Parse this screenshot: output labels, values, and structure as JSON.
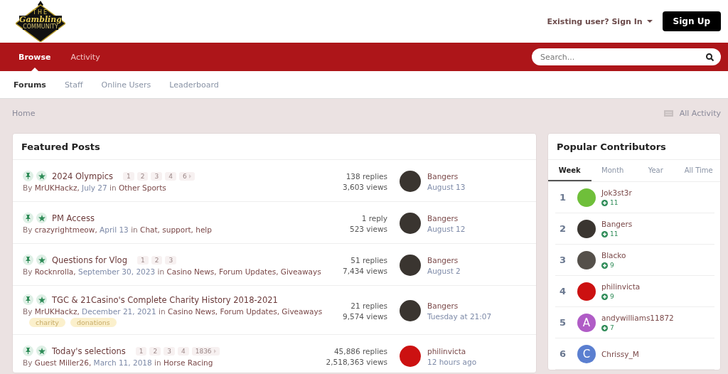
{
  "logo": {
    "top": "THE",
    "middle": "Gambling",
    "bottom": "COMMUNITY"
  },
  "user_bar": {
    "sign_in": "Existing user? Sign In",
    "sign_up": "Sign Up"
  },
  "nav_tabs": [
    {
      "label": "Browse",
      "selected": true
    },
    {
      "label": "Activity",
      "selected": false
    }
  ],
  "search": {
    "placeholder": "Search..."
  },
  "sub_tabs": [
    {
      "label": "Forums",
      "selected": true
    },
    {
      "label": "Staff",
      "selected": false
    },
    {
      "label": "Online Users",
      "selected": false
    },
    {
      "label": "Leaderboard",
      "selected": false
    }
  ],
  "breadcrumb": {
    "home": "Home",
    "all_activity": "All Activity"
  },
  "featured": {
    "title": "Featured Posts",
    "posts": [
      {
        "title": "2024 Olympics",
        "pinned": true,
        "featured": true,
        "pages": [
          {
            "label": "1",
            "kind": "page"
          },
          {
            "label": "2",
            "kind": "page"
          },
          {
            "label": "3",
            "kind": "page"
          },
          {
            "label": "4",
            "kind": "page"
          },
          {
            "label": "6",
            "kind": "last"
          }
        ],
        "meta": [
          {
            "kind": "text",
            "text": "By"
          },
          {
            "kind": "link",
            "text": "MrUKHackz,"
          },
          {
            "kind": "date",
            "text": "July 27"
          },
          {
            "kind": "text",
            "text": "in"
          },
          {
            "kind": "link",
            "text": "Other Sports"
          }
        ],
        "replies": "138 replies",
        "views": "3,603 views",
        "last_user": "Bangers",
        "last_time": "August 13",
        "color": "#3a3530"
      },
      {
        "title": "PM Access",
        "pinned": true,
        "featured": true,
        "meta": [
          {
            "kind": "text",
            "text": "By"
          },
          {
            "kind": "link",
            "text": "crazyrightmeow,"
          },
          {
            "kind": "date",
            "text": "April 13"
          },
          {
            "kind": "text",
            "text": "in"
          },
          {
            "kind": "link",
            "text": "Chat, support, help"
          }
        ],
        "replies": "1 reply",
        "views": "523 views",
        "last_user": "Bangers",
        "last_time": "August 12",
        "color": "#3a3530"
      },
      {
        "title": "Questions for Vlog",
        "pinned": true,
        "featured": true,
        "pages": [
          {
            "label": "1",
            "kind": "page"
          },
          {
            "label": "2",
            "kind": "page"
          },
          {
            "label": "3",
            "kind": "page"
          }
        ],
        "meta": [
          {
            "kind": "text",
            "text": "By"
          },
          {
            "kind": "link",
            "text": "Rocknrolla,"
          },
          {
            "kind": "date",
            "text": "September 30, 2023"
          },
          {
            "kind": "text",
            "text": "in"
          },
          {
            "kind": "link",
            "text": "Casino News, Forum Updates, Giveaways"
          }
        ],
        "replies": "51 replies",
        "views": "7,434 views",
        "last_user": "Bangers",
        "last_time": "August 2",
        "color": "#3a3530"
      },
      {
        "title": "TGC & 21Casino's Complete Charity History 2018-2021",
        "pinned": true,
        "featured": true,
        "meta": [
          {
            "kind": "text",
            "text": "By"
          },
          {
            "kind": "link",
            "text": "MrUKHackz,"
          },
          {
            "kind": "date",
            "text": "December 21, 2021"
          },
          {
            "kind": "text",
            "text": "in"
          },
          {
            "kind": "link",
            "text": "Casino News, Forum Updates, Giveaways"
          }
        ],
        "tags": [
          "charity",
          "donations"
        ],
        "replies": "21 replies",
        "views": "9,574 views",
        "last_user": "Bangers",
        "last_time": "Tuesday at 21:07",
        "color": "#3a3530"
      },
      {
        "title": "Today's selections",
        "pinned": true,
        "featured": true,
        "pages": [
          {
            "label": "1",
            "kind": "page"
          },
          {
            "label": "2",
            "kind": "page"
          },
          {
            "label": "3",
            "kind": "page"
          },
          {
            "label": "4",
            "kind": "page"
          },
          {
            "label": "1836",
            "kind": "last"
          }
        ],
        "meta": [
          {
            "kind": "text",
            "text": "By"
          },
          {
            "kind": "link",
            "text": "Guest Miller26,"
          },
          {
            "kind": "date",
            "text": "March 11, 2018"
          },
          {
            "kind": "text",
            "text": "in"
          },
          {
            "kind": "link",
            "text": "Horse Racing"
          }
        ],
        "replies": "45,886 replies",
        "views": "2,518,363 views",
        "last_user": "philinvicta",
        "last_time": "12 hours ago",
        "color": "#cc1111"
      }
    ]
  },
  "contributors": {
    "title": "Popular Contributors",
    "tabs": [
      {
        "label": "Week",
        "selected": true
      },
      {
        "label": "Month",
        "selected": false
      },
      {
        "label": "Year",
        "selected": false
      },
      {
        "label": "All Time",
        "selected": false
      }
    ],
    "items": [
      {
        "rank": "1",
        "name": "Jok3st3r",
        "points": "11",
        "color": "#6fbf3a"
      },
      {
        "rank": "2",
        "name": "Bangers",
        "points": "11",
        "color": "#3a3530"
      },
      {
        "rank": "3",
        "name": "Blacko",
        "points": "9",
        "color": "#55504a"
      },
      {
        "rank": "4",
        "name": "philinvicta",
        "points": "9",
        "color": "#cc1111"
      },
      {
        "rank": "5",
        "name": "andywilliams11872",
        "points": "7",
        "color": "#b05cc6",
        "letter": "A"
      },
      {
        "rank": "6",
        "name": "Chrissy_M",
        "color": "#5b7fd0",
        "letter": "C"
      }
    ]
  }
}
